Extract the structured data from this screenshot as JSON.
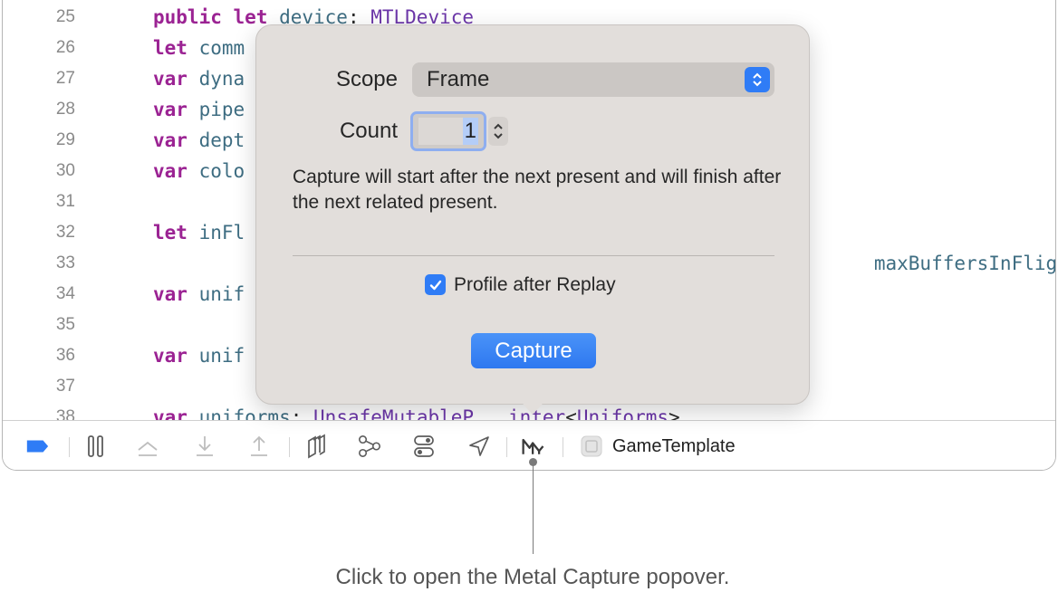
{
  "editor": {
    "lines": [
      {
        "num": "25",
        "parts": [
          {
            "t": "public let ",
            "c": "kw"
          },
          {
            "t": "device",
            "c": "id"
          },
          {
            "t": ": ",
            "c": ""
          },
          {
            "t": "MTLDevice",
            "c": "ty"
          }
        ]
      },
      {
        "num": "26",
        "parts": [
          {
            "t": "let ",
            "c": "kw"
          },
          {
            "t": "comm",
            "c": "id"
          }
        ]
      },
      {
        "num": "27",
        "parts": [
          {
            "t": "var ",
            "c": "kw"
          },
          {
            "t": "dyna",
            "c": "id"
          }
        ]
      },
      {
        "num": "28",
        "parts": [
          {
            "t": "var ",
            "c": "kw"
          },
          {
            "t": "pipe",
            "c": "id"
          }
        ]
      },
      {
        "num": "29",
        "parts": [
          {
            "t": "var ",
            "c": "kw"
          },
          {
            "t": "dept",
            "c": "id"
          }
        ]
      },
      {
        "num": "30",
        "parts": [
          {
            "t": "var ",
            "c": "kw"
          },
          {
            "t": "colo",
            "c": "id"
          }
        ]
      },
      {
        "num": "31",
        "parts": []
      },
      {
        "num": "32",
        "parts": [
          {
            "t": "let ",
            "c": "kw"
          },
          {
            "t": "inFl",
            "c": "id"
          }
        ]
      },
      {
        "num": "33",
        "parts": []
      },
      {
        "num": "34",
        "parts": [
          {
            "t": "var ",
            "c": "kw"
          },
          {
            "t": "unif",
            "c": "id"
          }
        ]
      },
      {
        "num": "35",
        "parts": []
      },
      {
        "num": "36",
        "parts": [
          {
            "t": "var ",
            "c": "kw"
          },
          {
            "t": "unif",
            "c": "id"
          }
        ]
      },
      {
        "num": "37",
        "parts": []
      },
      {
        "num": "38",
        "parts": [
          {
            "t": "var ",
            "c": "kw"
          },
          {
            "t": "uniforms",
            "c": "id"
          },
          {
            "t": ": ",
            "c": ""
          },
          {
            "t": "UnsafeMutableP",
            "c": "ty"
          },
          {
            "t": "   ",
            "c": ""
          },
          {
            "t": "inter",
            "c": "ty"
          },
          {
            "t": "<",
            "c": ""
          },
          {
            "t": "Uniforms",
            "c": "ty"
          },
          {
            "t": ">",
            "c": ""
          }
        ]
      }
    ],
    "right_fragment": "maxBuffersInFlight)"
  },
  "debug_bar": {
    "icons": [
      "breakpoint-toggle-icon",
      "pause-icon",
      "step-over-icon",
      "step-into-icon",
      "step-out-icon",
      "view-hierarchy-icon",
      "memory-graph-icon",
      "environment-overrides-icon",
      "simulate-location-icon",
      "metal-capture-icon"
    ],
    "scheme": "GameTemplate"
  },
  "popover": {
    "scope_label": "Scope",
    "scope_value": "Frame",
    "count_label": "Count",
    "count_value": "1",
    "description": "Capture will start after the next present and will finish after the next related present.",
    "profile_label": "Profile after Replay",
    "profile_checked": true,
    "capture_button": "Capture"
  },
  "callout": {
    "text": "Click to open the Metal Capture popover."
  },
  "colors": {
    "accent": "#2f7cf6",
    "keyword": "#9b2393",
    "identifier": "#3e6d82",
    "type": "#6c36a9",
    "popover_bg": "#e2dedb"
  }
}
